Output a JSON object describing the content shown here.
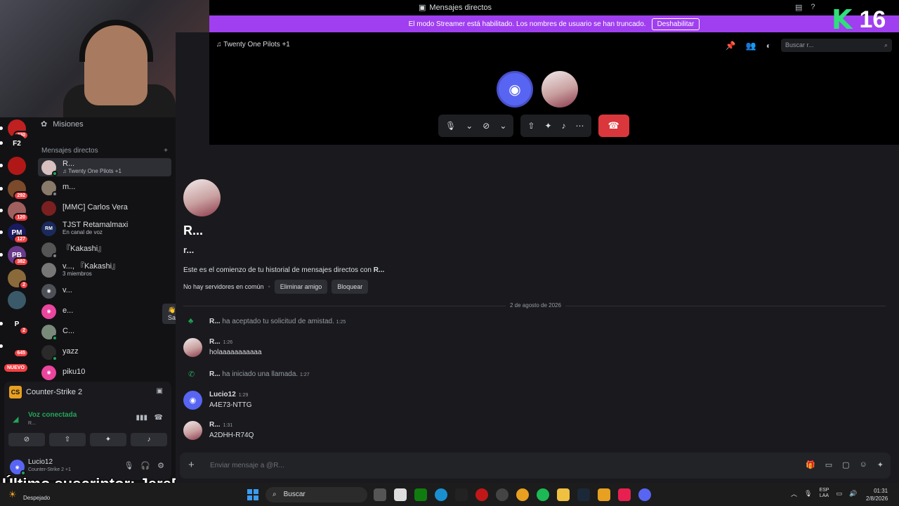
{
  "window": {
    "title": "Mensajes directos"
  },
  "brand": {
    "letter": "K",
    "number": "16"
  },
  "streamer_banner": {
    "text": "El modo Streamer está habilitado. Los nombres de usuario se han truncado.",
    "button": "Deshabilitar"
  },
  "servers": [
    {
      "label": "",
      "badge": "430"
    },
    {
      "label": "F2",
      "badge": ""
    },
    {
      "label": "",
      "badge": ""
    },
    {
      "label": "",
      "badge": "292"
    },
    {
      "label": "",
      "badge": "120"
    },
    {
      "label": "PM",
      "badge": "127"
    },
    {
      "label": "PB",
      "badge": "382"
    },
    {
      "label": "",
      "badge": "2"
    },
    {
      "label": "",
      "badge": ""
    },
    {
      "label": "P",
      "badge": "2"
    },
    {
      "label": "",
      "badge": "645"
    }
  ],
  "servers_new_label": "NUEVO",
  "sidebar": {
    "misiones": "Misiones",
    "dm_header": "Mensajes directos",
    "dm_add": "+",
    "dms": [
      {
        "name": "R...",
        "sub": "♫ Twenty One Pilots +1",
        "avatar": "",
        "active": true
      },
      {
        "name": "m...",
        "sub": "",
        "avatar": ""
      },
      {
        "name": "[MMC] Carlos Vera",
        "sub": "",
        "avatar": ""
      },
      {
        "name": "TJST Retamalmaxi",
        "sub": "En canal de voz",
        "avatar": "RM"
      },
      {
        "name": "『Kakashi』",
        "sub": "",
        "avatar": ""
      },
      {
        "name": "v..., 『Kakashi』",
        "sub": "3 miembros",
        "avatar": ""
      },
      {
        "name": "v...",
        "sub": "",
        "avatar": ""
      },
      {
        "name": "e...",
        "sub": "",
        "avatar": ""
      },
      {
        "name": "C...",
        "sub": "",
        "avatar": ""
      },
      {
        "name": "yazz",
        "sub": "",
        "avatar": ""
      },
      {
        "name": "piku10",
        "sub": "",
        "avatar": ""
      }
    ],
    "saluda": "👋 Saluda"
  },
  "voice_panel": {
    "game": "Counter-Strike 2",
    "status": "Voz conectada",
    "channel": "R..."
  },
  "user": {
    "name": "Lucio12",
    "status": "Counter-Strike 2 +1"
  },
  "subscriber_overlay": "Último suscriptor: JereBMW",
  "call": {
    "activity": "♫ Twenty One Pilots +1",
    "search_placeholder": "Buscar r..."
  },
  "profile": {
    "display_name": "R...",
    "username": "r...",
    "intro_prefix": "Este es el comienzo de tu historial de mensajes directos con ",
    "intro_name": "R...",
    "no_servers": "No hay servidores en común",
    "remove_friend": "Eliminar amigo",
    "block": "Bloquear"
  },
  "date_divider": "2 de agosto de 2026",
  "messages": [
    {
      "type": "system",
      "author": "R...",
      "text": " ha aceptado tu solicitud de amistad.",
      "time": "1:25"
    },
    {
      "type": "message",
      "author": "R...",
      "time": "1:26",
      "text": "holaaaaaaaaaaa"
    },
    {
      "type": "system",
      "author": "R...",
      "text": " ha iniciado una llamada.",
      "time": "1:27"
    },
    {
      "type": "message",
      "author": "Lucio12",
      "time": "1:29",
      "text": "A4E73-NTTG"
    },
    {
      "type": "message",
      "author": "R...",
      "time": "1:31",
      "text": "A2DHH-R74Q"
    }
  ],
  "composer": {
    "placeholder": "Enviar mensaje a @R..."
  },
  "taskbar": {
    "weather": "Despejado",
    "search": "Buscar",
    "lang_1": "ESP",
    "lang_2": "LAA",
    "time": "01:31",
    "date": "2/8/2026"
  }
}
